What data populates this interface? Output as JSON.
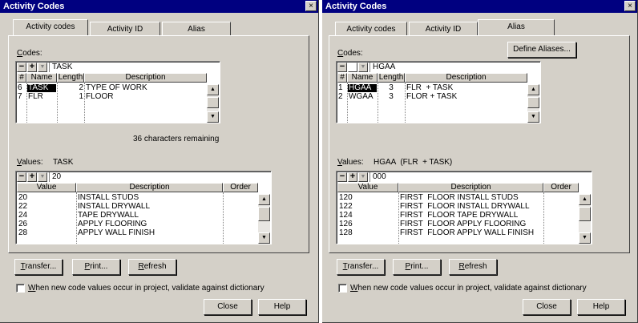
{
  "left": {
    "title": "Activity Codes",
    "close_glyph": "×",
    "tabs": [
      "Activity codes",
      "Activity ID",
      "Alias"
    ],
    "codes_label": "Codes:",
    "codes_input": "TASK",
    "codes_headers": [
      "#",
      "Name",
      "Length",
      "Description"
    ],
    "codes_rows": [
      {
        "num": "6",
        "name": "TASK",
        "length": "2",
        "desc": "TYPE OF WORK"
      },
      {
        "num": "7",
        "name": "FLR",
        "length": "1",
        "desc": "FLOOR"
      }
    ],
    "remaining": "36 characters remaining",
    "values_label": "Values:",
    "values_code": "TASK",
    "values_input": "20",
    "values_headers": [
      "Value",
      "Description",
      "Order"
    ],
    "values_rows": [
      {
        "value": "20",
        "desc": "INSTALL STUDS"
      },
      {
        "value": "22",
        "desc": "INSTALL DRYWALL"
      },
      {
        "value": "24",
        "desc": "TAPE DRYWALL"
      },
      {
        "value": "26",
        "desc": "APPLY FLOORING"
      },
      {
        "value": "28",
        "desc": "APPLY WALL FINISH"
      }
    ],
    "buttons": {
      "transfer": "Transfer...",
      "print": "Print...",
      "refresh": "Refresh",
      "close": "Close",
      "help": "Help"
    },
    "checkbox_label": "When new code values occur in project, validate against dictionary"
  },
  "right": {
    "title": "Activity Codes",
    "close_glyph": "×",
    "tabs": [
      "Activity codes",
      "Activity ID",
      "Alias"
    ],
    "define_aliases": "Define Aliases...",
    "codes_label": "Codes:",
    "codes_input": "HGAA",
    "codes_headers": [
      "#",
      "Name",
      "Length",
      "Description"
    ],
    "codes_rows": [
      {
        "num": "1",
        "name": "HGAA",
        "length": "3",
        "desc": "FLR  + TASK"
      },
      {
        "num": "2",
        "name": "WGAA",
        "length": "3",
        "desc": "FLOR + TASK"
      }
    ],
    "values_label": "Values:",
    "values_code": "HGAA  (FLR  + TASK)",
    "values_input": "000",
    "values_headers": [
      "Value",
      "Description",
      "Order"
    ],
    "values_rows": [
      {
        "value": "120",
        "desc": "FIRST  FLOOR INSTALL STUDS"
      },
      {
        "value": "122",
        "desc": "FIRST  FLOOR INSTALL DRYWALL"
      },
      {
        "value": "124",
        "desc": "FIRST  FLOOR TAPE DRYWALL"
      },
      {
        "value": "126",
        "desc": "FIRST  FLOOR APPLY FLOORING"
      },
      {
        "value": "128",
        "desc": "FIRST  FLOOR APPLY WALL FINISH"
      }
    ],
    "buttons": {
      "transfer": "Transfer...",
      "print": "Print...",
      "refresh": "Refresh",
      "close": "Close",
      "help": "Help"
    },
    "checkbox_label": "When new code values occur in project, validate against dictionary"
  }
}
